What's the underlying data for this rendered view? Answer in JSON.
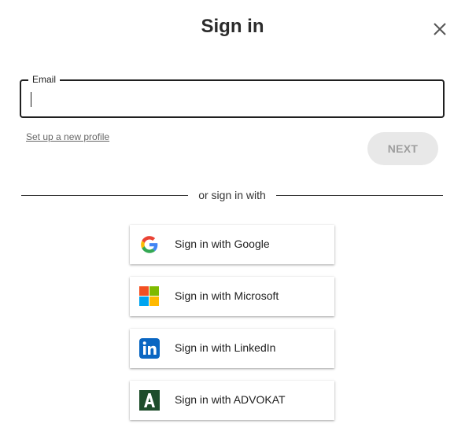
{
  "dialog": {
    "title": "Sign in",
    "close_icon": "close-icon"
  },
  "email": {
    "label": "Email",
    "value": "",
    "placeholder": ""
  },
  "links": {
    "new_profile": "Set up a new profile"
  },
  "actions": {
    "next_label": "NEXT"
  },
  "divider": {
    "text": "or sign in with"
  },
  "providers": [
    {
      "label": "Sign in with Google",
      "icon": "google-icon"
    },
    {
      "label": "Sign in with Microsoft",
      "icon": "microsoft-icon"
    },
    {
      "label": "Sign in with LinkedIn",
      "icon": "linkedin-icon"
    },
    {
      "label": "Sign in with ADVOKAT",
      "icon": "advokat-icon"
    }
  ],
  "colors": {
    "google_blue": "#4285F4",
    "google_red": "#EA4335",
    "google_yellow": "#FBBC05",
    "google_green": "#34A853",
    "ms_red": "#F25022",
    "ms_green": "#7FBA00",
    "ms_blue": "#00A4EF",
    "ms_yellow": "#FFB900",
    "linkedin_blue": "#0A66C2",
    "advokat_green": "#1E4D2B",
    "next_disabled_bg": "#e8e8e8",
    "next_disabled_text": "#9e9e9e"
  }
}
